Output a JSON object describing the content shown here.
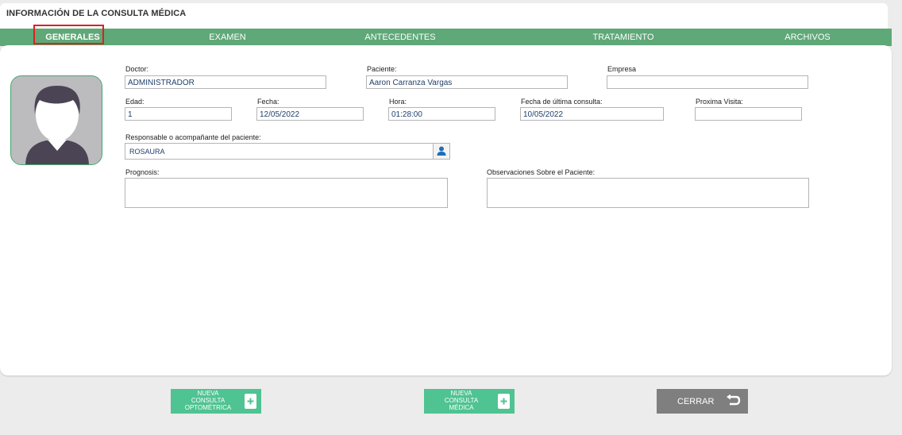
{
  "header": {
    "title": "INFORMACIÓN DE LA CONSULTA MÉDICA"
  },
  "tabs": [
    {
      "label": "GENERALES"
    },
    {
      "label": "EXAMEN"
    },
    {
      "label": "ANTECEDENTES"
    },
    {
      "label": "TRATAMIENTO"
    },
    {
      "label": "ARCHIVOS"
    }
  ],
  "form": {
    "doctor": {
      "label": "Doctor:",
      "value": "ADMINISTRADOR"
    },
    "paciente": {
      "label": "Paciente:",
      "value": "Aaron Carranza Vargas"
    },
    "empresa": {
      "label": "Empresa",
      "value": ""
    },
    "edad": {
      "label": "Edad:",
      "value": "1"
    },
    "fecha": {
      "label": "Fecha:",
      "value": "12/05/2022"
    },
    "hora": {
      "label": "Hora:",
      "value": "01:28:00"
    },
    "ultima": {
      "label": "Fecha de última consulta:",
      "value": "10/05/2022"
    },
    "proxima": {
      "label": "Proxima Visita:",
      "value": ""
    },
    "responsable": {
      "label": "Responsable o acompañante del paciente:",
      "value": "ROSAURA"
    },
    "prognosis": {
      "label": "Prognosis:",
      "value": ""
    },
    "observaciones": {
      "label": "Observaciones Sobre el Paciente:",
      "value": ""
    }
  },
  "buttons": {
    "optometrica": {
      "line1": "NUEVA",
      "line2": "CONSULTA",
      "line3": "OPTOMÉTRICA",
      "icon": "plus-icon"
    },
    "medica": {
      "line1": "NUEVA",
      "line2": "CONSULTA",
      "line3": "MÉDICA",
      "icon": "plus-icon"
    },
    "cerrar": {
      "label": "CERRAR",
      "icon": "return-arrow-icon"
    }
  },
  "colors": {
    "tab_bar": "#5fa878",
    "button_green": "#4fc392",
    "button_gray": "#7f7f7f",
    "highlight": "#d9231f"
  }
}
